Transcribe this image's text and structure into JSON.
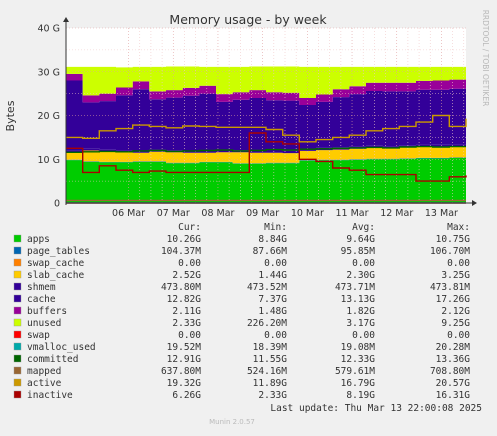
{
  "chart_data": {
    "type": "area",
    "title": "Memory usage - by week",
    "ylabel": "Bytes",
    "ylim": [
      0,
      40
    ],
    "y_unit": "G",
    "y_ticks": [
      {
        "v": 0,
        "label": "0"
      },
      {
        "v": 10,
        "label": "10 G"
      },
      {
        "v": 20,
        "label": "20 G"
      },
      {
        "v": 30,
        "label": "30 G"
      },
      {
        "v": 40,
        "label": "40 G"
      }
    ],
    "x_ticks": [
      "06 Mar",
      "07 Mar",
      "08 Mar",
      "09 Mar",
      "10 Mar",
      "11 Mar",
      "12 Mar",
      "13 Mar"
    ],
    "x_range_days": [
      4.6,
      13.55
    ],
    "x_tick_days": [
      6,
      7,
      8,
      9,
      10,
      11,
      12,
      13
    ],
    "grid": true,
    "watermark": "RRDTOOL / TOBI OETIKER",
    "legend_header": [
      "Cur:",
      "Min:",
      "Avg:",
      "Max:"
    ],
    "stacked_series": [
      {
        "name": "apps",
        "color": "#00cc00",
        "values": [
          9.8,
          9.4,
          9.3,
          9.3,
          9.4,
          9.4,
          9.1,
          9.1,
          9.3,
          9.3,
          9.0,
          9.0,
          9.1,
          9.1,
          9.7,
          9.8,
          9.8,
          9.9,
          10.0,
          10.0,
          10.1,
          10.2,
          10.2,
          10.3,
          10.3
        ]
      },
      {
        "name": "page_tables",
        "color": "#0066b3",
        "values": [
          0.1,
          0.1,
          0.1,
          0.1,
          0.1,
          0.1,
          0.1,
          0.1,
          0.1,
          0.1,
          0.1,
          0.1,
          0.1,
          0.1,
          0.1,
          0.1,
          0.1,
          0.1,
          0.1,
          0.1,
          0.1,
          0.1,
          0.1,
          0.1,
          0.1
        ]
      },
      {
        "name": "swap_cache",
        "color": "#ff8000",
        "values": [
          0,
          0,
          0,
          0,
          0,
          0,
          0,
          0,
          0,
          0,
          0,
          0,
          0,
          0,
          0,
          0,
          0,
          0,
          0,
          0,
          0,
          0,
          0,
          0,
          0
        ]
      },
      {
        "name": "slab_cache",
        "color": "#ffcc00",
        "values": [
          1.7,
          2.5,
          2.4,
          2.2,
          2.0,
          2.2,
          2.4,
          2.3,
          2.1,
          2.2,
          2.5,
          2.4,
          2.3,
          2.2,
          2.1,
          2.2,
          2.3,
          2.4,
          2.5,
          2.4,
          2.5,
          2.6,
          2.5,
          2.5,
          2.5
        ]
      },
      {
        "name": "shmem",
        "color": "#330099",
        "values": [
          0.5,
          0.5,
          0.5,
          0.5,
          0.5,
          0.5,
          0.5,
          0.5,
          0.5,
          0.5,
          0.5,
          0.5,
          0.5,
          0.5,
          0.5,
          0.5,
          0.5,
          0.5,
          0.5,
          0.5,
          0.5,
          0.5,
          0.5,
          0.5,
          0.5
        ]
      },
      {
        "name": "cache",
        "color": "#330099",
        "values": [
          15.9,
          10.5,
          11.0,
          12.5,
          14.0,
          11.5,
          12.0,
          12.5,
          13.0,
          11.0,
          11.5,
          12.0,
          11.5,
          11.5,
          10.0,
          10.5,
          11.5,
          12.0,
          12.5,
          12.5,
          12.3,
          12.5,
          12.6,
          12.7,
          12.8
        ]
      },
      {
        "name": "buffers",
        "color": "#990099",
        "values": [
          1.5,
          1.6,
          1.7,
          1.8,
          1.8,
          1.8,
          1.7,
          1.8,
          1.8,
          1.8,
          1.7,
          1.8,
          1.8,
          1.8,
          1.6,
          1.7,
          1.8,
          1.8,
          1.9,
          2.0,
          2.0,
          2.0,
          2.1,
          2.1,
          2.1
        ]
      },
      {
        "name": "unused",
        "color": "#ccff00",
        "values": [
          1.6,
          6.5,
          6.1,
          4.6,
          3.3,
          5.6,
          5.4,
          4.9,
          4.3,
          6.2,
          5.8,
          5.4,
          5.9,
          6.0,
          7.1,
          6.3,
          5.1,
          4.4,
          3.6,
          3.6,
          3.6,
          3.2,
          3.1,
          2.9,
          2.8
        ]
      }
    ],
    "line_series": [
      {
        "name": "swap",
        "color": "#ff0000",
        "values": [
          0,
          0,
          0,
          0,
          0,
          0,
          0,
          0,
          0,
          0,
          0,
          0,
          0,
          0,
          0,
          0,
          0,
          0,
          0,
          0,
          0,
          0,
          0,
          0,
          0
        ]
      },
      {
        "name": "vmalloc_used",
        "color": "#00aaaa",
        "values": [
          0.02,
          0.02,
          0.02,
          0.02,
          0.02,
          0.02,
          0.02,
          0.02,
          0.02,
          0.02,
          0.02,
          0.02,
          0.02,
          0.02,
          0.02,
          0.02,
          0.02,
          0.02,
          0.02,
          0.02,
          0.02,
          0.02,
          0.02,
          0.02,
          0.02
        ]
      },
      {
        "name": "committed",
        "color": "#006600",
        "values": [
          11.6,
          11.7,
          11.8,
          11.7,
          11.9,
          12.0,
          11.8,
          11.9,
          12.0,
          12.1,
          11.9,
          12.0,
          12.2,
          12.1,
          12.3,
          12.4,
          12.5,
          12.6,
          12.7,
          12.6,
          12.8,
          12.9,
          12.8,
          12.9,
          12.9
        ]
      },
      {
        "name": "mapped",
        "color": "#996633",
        "values": [
          0.6,
          0.6,
          0.6,
          0.6,
          0.6,
          0.6,
          0.6,
          0.6,
          0.6,
          0.6,
          0.6,
          0.6,
          0.6,
          0.6,
          0.6,
          0.6,
          0.6,
          0.6,
          0.6,
          0.6,
          0.6,
          0.6,
          0.6,
          0.6,
          0.6
        ]
      },
      {
        "name": "active",
        "color": "#cc9900",
        "values": [
          15.0,
          14.8,
          16.5,
          17.0,
          17.8,
          17.5,
          17.2,
          17.6,
          17.5,
          17.3,
          17.3,
          17.3,
          16.8,
          15.5,
          14.0,
          14.5,
          15.0,
          15.5,
          16.5,
          17.0,
          17.5,
          18.5,
          20.0,
          17.5,
          19.3
        ]
      },
      {
        "name": "inactive",
        "color": "#aa0000",
        "values": [
          12.5,
          7.0,
          8.5,
          7.5,
          7.0,
          7.3,
          7.0,
          7.0,
          7.0,
          7.0,
          7.0,
          16.0,
          14.0,
          13.5,
          10.0,
          9.5,
          8.0,
          7.5,
          6.5,
          6.5,
          6.5,
          5.0,
          5.0,
          6.0,
          6.3
        ]
      }
    ],
    "legend": [
      {
        "name": "apps",
        "color": "#00cc00",
        "cur": "10.26G",
        "min": "8.84G",
        "avg": "9.64G",
        "max": "10.75G"
      },
      {
        "name": "page_tables",
        "color": "#0066b3",
        "cur": "104.37M",
        "min": "87.66M",
        "avg": "95.85M",
        "max": "106.70M"
      },
      {
        "name": "swap_cache",
        "color": "#ff8000",
        "cur": "0.00",
        "min": "0.00",
        "avg": "0.00",
        "max": "0.00"
      },
      {
        "name": "slab_cache",
        "color": "#ffcc00",
        "cur": "2.52G",
        "min": "1.44G",
        "avg": "2.30G",
        "max": "3.25G"
      },
      {
        "name": "shmem",
        "color": "#330099",
        "cur": "473.80M",
        "min": "473.52M",
        "avg": "473.71M",
        "max": "473.81M"
      },
      {
        "name": "cache",
        "color": "#330099",
        "cur": "12.82G",
        "min": "7.37G",
        "avg": "13.13G",
        "max": "17.26G"
      },
      {
        "name": "buffers",
        "color": "#990099",
        "cur": "2.11G",
        "min": "1.48G",
        "avg": "1.82G",
        "max": "2.12G"
      },
      {
        "name": "unused",
        "color": "#ccff00",
        "cur": "2.33G",
        "min": "226.20M",
        "avg": "3.17G",
        "max": "9.25G"
      },
      {
        "name": "swap",
        "color": "#ff0000",
        "cur": "0.00",
        "min": "0.00",
        "avg": "0.00",
        "max": "0.00"
      },
      {
        "name": "vmalloc_used",
        "color": "#00aaaa",
        "cur": "19.52M",
        "min": "18.39M",
        "avg": "19.08M",
        "max": "20.28M"
      },
      {
        "name": "committed",
        "color": "#006600",
        "cur": "12.91G",
        "min": "11.55G",
        "avg": "12.33G",
        "max": "13.36G"
      },
      {
        "name": "mapped",
        "color": "#996633",
        "cur": "637.80M",
        "min": "524.16M",
        "avg": "579.61M",
        "max": "708.80M"
      },
      {
        "name": "active",
        "color": "#cc9900",
        "cur": "19.32G",
        "min": "11.89G",
        "avg": "16.79G",
        "max": "20.57G"
      },
      {
        "name": "inactive",
        "color": "#aa0000",
        "cur": "6.26G",
        "min": "2.33G",
        "avg": "8.19G",
        "max": "16.31G"
      }
    ],
    "last_update": "Last update: Thu Mar 13 22:00:08 2025",
    "footer": "Munin 2.0.57"
  }
}
